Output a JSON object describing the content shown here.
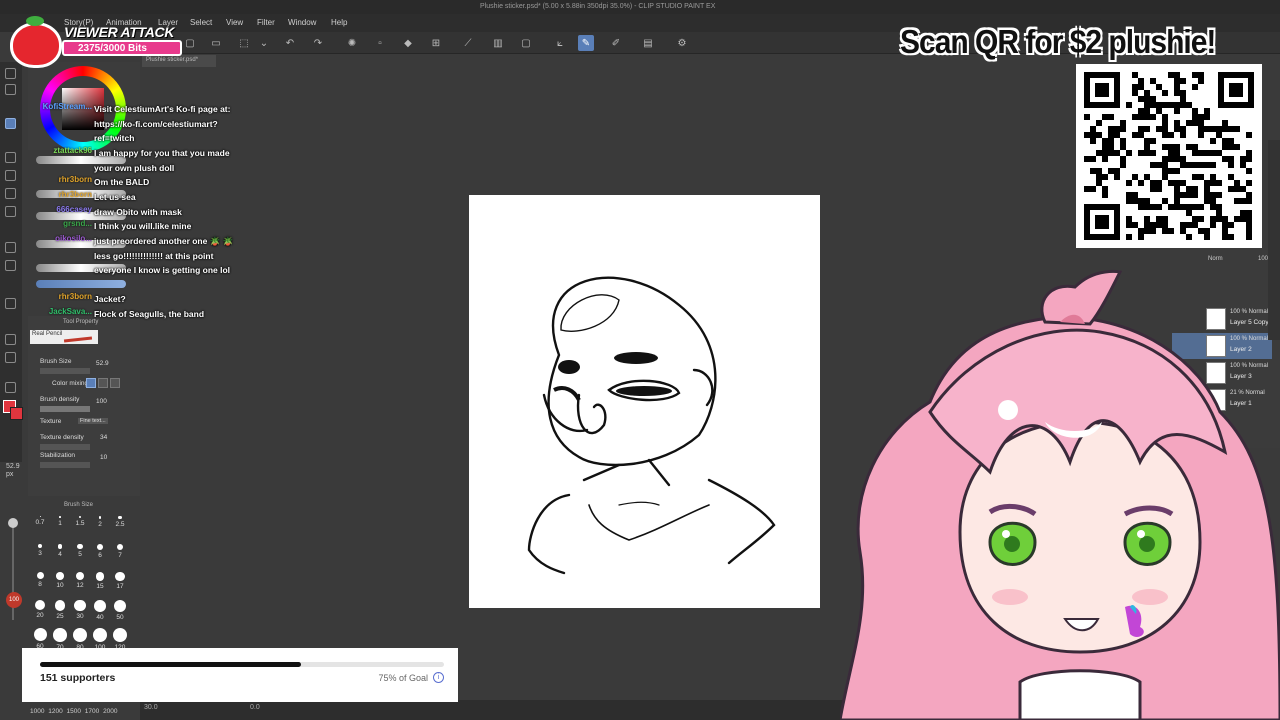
{
  "window": {
    "title": "Plushie sticker.psd* (5.00 x 5.88in 350dpi 35.0%) - CLIP STUDIO PAINT EX"
  },
  "menu": [
    "Story(P)",
    "Animation",
    "Layer",
    "Select",
    "View",
    "Filter",
    "Window",
    "Help"
  ],
  "document_tab": "Plushie sticker.psd*",
  "viewer_attack": {
    "title": "VIEWER ATTACK",
    "progress_text": "2375/3000 Bits"
  },
  "chat": [
    {
      "user": "KofiStream...",
      "user_color": "#5aa0ff",
      "message": "Visit CelestiumArt's Ko-fi page at: https://ko-fi.com/celestiumart?ref=twitch"
    },
    {
      "user": "ztattack96",
      "user_color": "#7bd957",
      "message": "I am happy for you that you made your own plush doll"
    },
    {
      "user": "rhr3born",
      "user_color": "#e0a32a",
      "message": "Om the BALD"
    },
    {
      "user": "rhr3born",
      "user_color": "#e0a32a",
      "message": "Let us sea"
    },
    {
      "user": "666casey",
      "user_color": "#8c7bf0",
      "message": "draw Obito with mask"
    },
    {
      "user": "grsnd...",
      "user_color": "#3aa64a",
      "message": "I think you will.like mine"
    },
    {
      "user": "oikosilo...",
      "user_color": "#9b59d0",
      "message": "just preordered another one 🪴 🪴 less go!!!!!!!!!!!!!! at this point everyone I know is getting one lol"
    },
    {
      "user": "rhr3born",
      "user_color": "#e0a32a",
      "message": "Jacket?"
    },
    {
      "user": "JackSava...",
      "user_color": "#2fbf6a",
      "message": "Flock of Seagulls, the band"
    }
  ],
  "tool_property": {
    "title": "Tool Property",
    "preset": "Real Pencil",
    "brush_size_label": "Brush Size",
    "brush_size_value": "52.9",
    "color_mixing_label": "Color mixing",
    "brush_density_label": "Brush density",
    "brush_density_value": "100",
    "texture_label": "Texture",
    "texture_value": "Fine text...",
    "texture_density_label": "Texture density",
    "texture_density_value": "34",
    "stabilization_label": "Stabilization",
    "stabilization_value": "10"
  },
  "brush_size_panel": {
    "title": "Brush Size",
    "sizes": [
      "0.7",
      "1",
      "1.5",
      "2",
      "2.5",
      "3",
      "4",
      "5",
      "6",
      "7",
      "8",
      "10",
      "12",
      "15",
      "17",
      "20",
      "25",
      "30",
      "40",
      "50",
      "60",
      "70",
      "80",
      "100",
      "120"
    ],
    "bottom_row": "1000 1200 1500 1700 2000"
  },
  "left_rail": {
    "size_value": "52.9",
    "size_unit": "px",
    "opacity": "100"
  },
  "canvas_ruler": {
    "left": "30.0",
    "right": "0.0"
  },
  "qr": {
    "heading": "Scan QR for $2 plushie!"
  },
  "layers": {
    "blend_label": "Norm",
    "opacity_top": "100",
    "rows": [
      {
        "mode": "100 % Normal",
        "name": "Layer 5 Copy",
        "selected": false
      },
      {
        "mode": "100 % Normal",
        "name": "Layer 2",
        "selected": true
      },
      {
        "mode": "100 % Normal",
        "name": "Layer 3",
        "selected": false
      },
      {
        "mode": "21 % Normal",
        "name": "Layer 1",
        "selected": false
      }
    ]
  },
  "goal": {
    "supporters": "151 supporters",
    "percent_text": "75% of Goal",
    "progress": 0.75
  },
  "colors": {
    "accent": "#5a7fb8",
    "brush_color": "#e0353e",
    "bits_bar": "#e83a8c",
    "hair_pink": "#f4a6c0"
  }
}
